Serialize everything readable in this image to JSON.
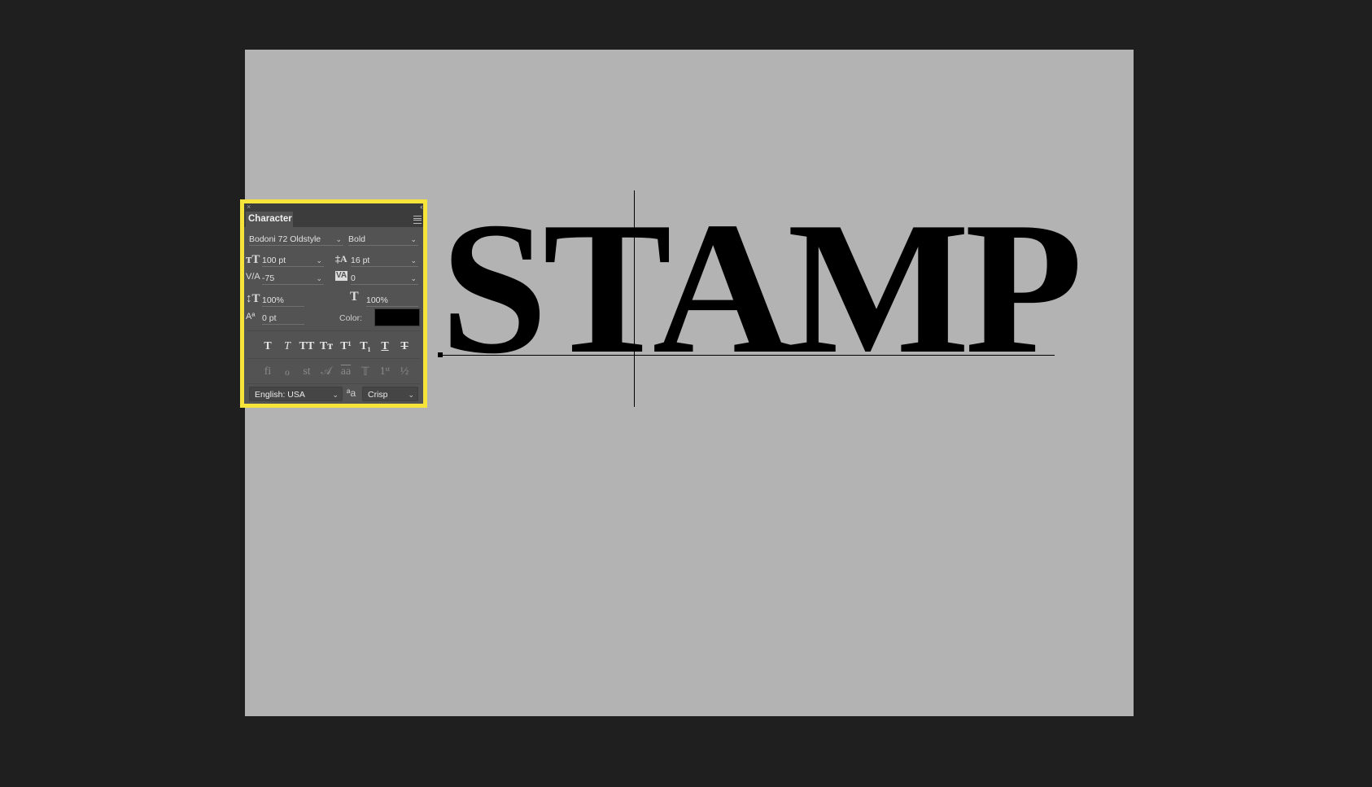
{
  "canvas": {
    "text": "STAMP"
  },
  "panel": {
    "title": "Character",
    "close_glyph": "×",
    "collapse_glyph": "‹‹",
    "font_family": "Bodoni 72 Oldstyle",
    "font_style": "Bold",
    "font_size": "100 pt",
    "leading": "16 pt",
    "kerning": "-75",
    "tracking": "0",
    "vertical_scale": "100%",
    "horizontal_scale": "100%",
    "baseline_shift": "0 pt",
    "color_label": "Color:",
    "color_value": "#000000",
    "chevron": "⌄",
    "type_buttons": [
      {
        "name": "faux-bold",
        "glyph": "T"
      },
      {
        "name": "faux-italic",
        "glyph": "T"
      },
      {
        "name": "all-caps",
        "glyph": "TT"
      },
      {
        "name": "small-caps",
        "glyph": "Tт"
      },
      {
        "name": "superscript",
        "glyph": "T¹"
      },
      {
        "name": "subscript",
        "glyph": "T₁"
      },
      {
        "name": "underline",
        "glyph": "T"
      },
      {
        "name": "strikethrough",
        "glyph": "T"
      }
    ],
    "opentype_buttons": [
      {
        "name": "ligatures",
        "glyph": "fi"
      },
      {
        "name": "discretionary-ligatures",
        "glyph": "ℴ"
      },
      {
        "name": "stylistic-alternates",
        "glyph": "st"
      },
      {
        "name": "swash",
        "glyph": "𝒜"
      },
      {
        "name": "titling-alternates",
        "glyph": "aa"
      },
      {
        "name": "contextual-alternates",
        "glyph": "𝕋"
      },
      {
        "name": "ordinals",
        "glyph": "1ˢᵗ"
      },
      {
        "name": "fractions",
        "glyph": "½"
      }
    ],
    "language": "English: USA",
    "antialias_icon": "ªa",
    "antialias": "Crisp"
  }
}
